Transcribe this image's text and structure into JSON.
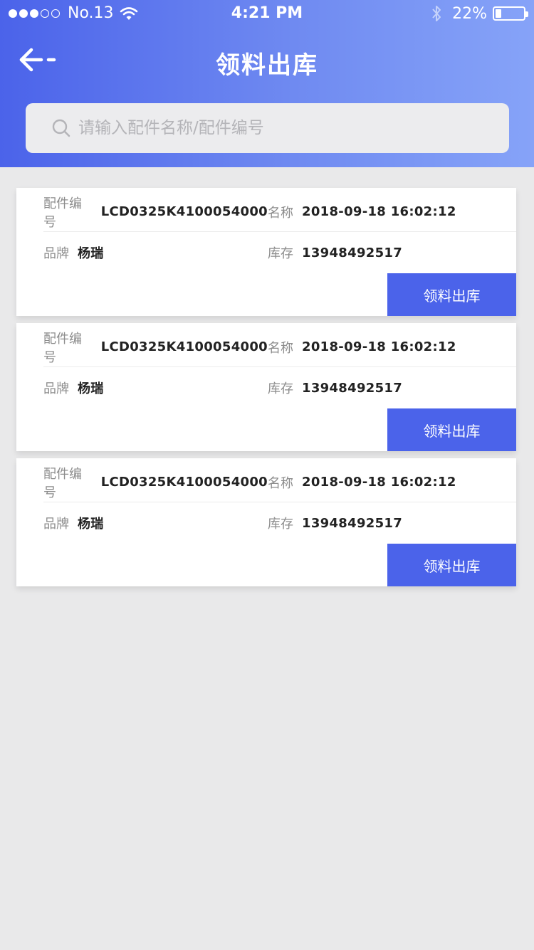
{
  "status_bar": {
    "carrier": "No.13",
    "time": "4:21 PM",
    "battery_pct": "22%",
    "battery_level": 0.22,
    "signal_dots_filled": 3,
    "signal_dots_total": 5,
    "icons": [
      "wifi-icon",
      "bluetooth-icon",
      "battery-icon"
    ]
  },
  "navbar": {
    "title": "领料出库",
    "back_icon": "arrow-left-icon"
  },
  "search": {
    "placeholder": "请输入配件名称/配件编号",
    "value": "",
    "icon": "search-icon"
  },
  "colors": {
    "accent": "#4b63ea",
    "header_gradient_start": "#4b63ea",
    "header_gradient_end": "#86a3f8",
    "background": "#e9e9ea"
  },
  "items": [
    {
      "part_no_label": "配件编号",
      "part_no": "LCD0325K4100054000",
      "name_label": "名称",
      "name": "2018-09-18 16:02:12",
      "brand_label": "品牌",
      "brand": "杨瑞",
      "stock_label": "库存",
      "stock": "13948492517",
      "action_label": "领料出库"
    },
    {
      "part_no_label": "配件编号",
      "part_no": "LCD0325K4100054000",
      "name_label": "名称",
      "name": "2018-09-18 16:02:12",
      "brand_label": "品牌",
      "brand": "杨瑞",
      "stock_label": "库存",
      "stock": "13948492517",
      "action_label": "领料出库"
    },
    {
      "part_no_label": "配件编号",
      "part_no": "LCD0325K4100054000",
      "name_label": "名称",
      "name": "2018-09-18 16:02:12",
      "brand_label": "品牌",
      "brand": "杨瑞",
      "stock_label": "库存",
      "stock": "13948492517",
      "action_label": "领料出库"
    }
  ]
}
